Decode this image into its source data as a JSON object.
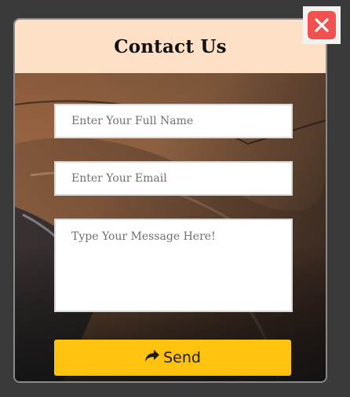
{
  "modal": {
    "title": "Contact Us",
    "fields": {
      "name_placeholder": "Enter Your Full Name",
      "email_placeholder": "Enter Your Email",
      "message_placeholder": "Type Your Message Here!"
    },
    "send_label": "Send"
  },
  "icons": {
    "close": "close-icon",
    "send": "share-arrow-icon"
  },
  "colors": {
    "header_bg": "#fde0c5",
    "send_button": "#ffc20e",
    "close_button": "#f0524f",
    "page_bg": "#3a3a3a"
  }
}
